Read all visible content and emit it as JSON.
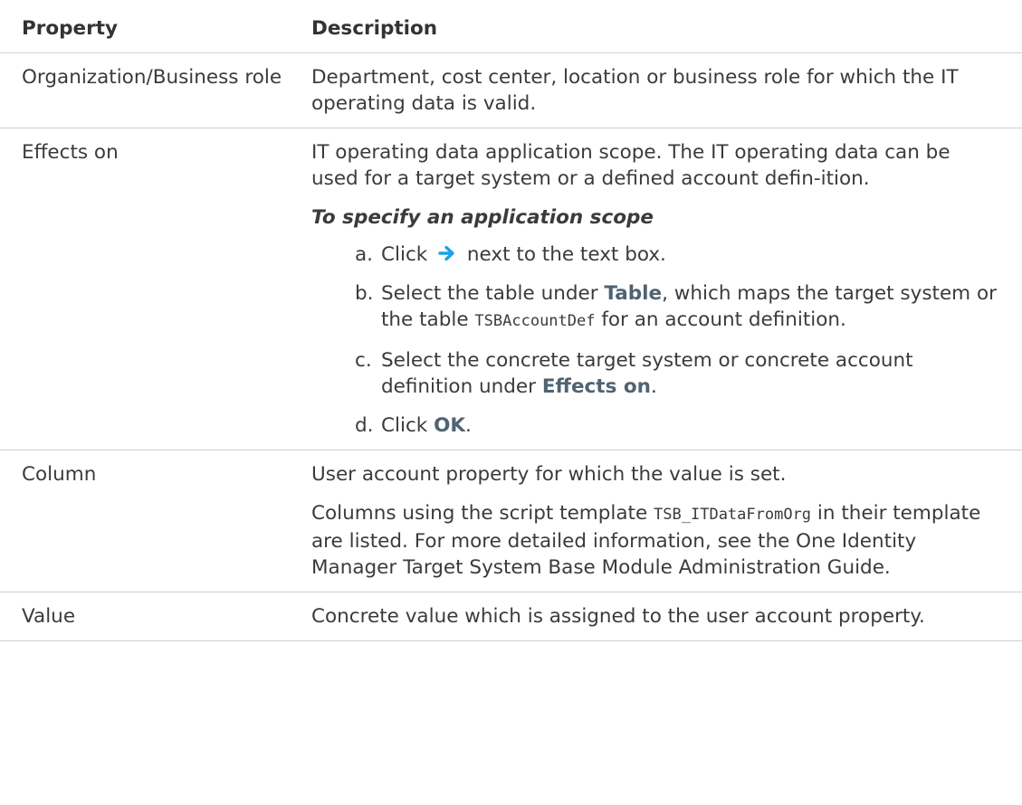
{
  "table": {
    "header": {
      "property": "Property",
      "description": "Description"
    },
    "rows": [
      {
        "property": "Organization/Business role",
        "description": "Department, cost center, location or business role for which the IT operating data is valid."
      },
      {
        "property": "Effects on",
        "description": "IT operating data application scope. The IT operating data can be used for a target system or a defined account defin-ition.",
        "procedure": {
          "title": "To specify an application scope",
          "steps": [
            {
              "marker": "a.",
              "before": "Click",
              "icon": "right-arrow-icon",
              "after": "next to the text box."
            },
            {
              "marker": "b.",
              "before": "Select the table under",
              "ui": "Table",
              "middle": ", which maps the target system or the table",
              "code": "TSBAccountDef",
              "after": "for an account definition."
            },
            {
              "marker": "c.",
              "before": "Select the concrete target system or concrete account definition under",
              "ui": "Effects on",
              "after": "."
            },
            {
              "marker": "d.",
              "before": "Click",
              "ui": "OK",
              "after": "."
            }
          ]
        }
      },
      {
        "property": "Column",
        "description": "User account property for which the value is set.",
        "description2": {
          "before": "Columns using the script template",
          "code": "TSB_ITDataFromOrg",
          "after": "in their template are listed. For more detailed information, see the One Identity Manager Target System Base Module Administration Guide."
        }
      },
      {
        "property": "Value",
        "description": "Concrete value which is assigned to the user account property."
      }
    ]
  },
  "colors": {
    "text": "#3b3b3b",
    "ui_term": "#4f6372",
    "arrow": "#1aa3e8",
    "rule": "#cfcfcf"
  }
}
